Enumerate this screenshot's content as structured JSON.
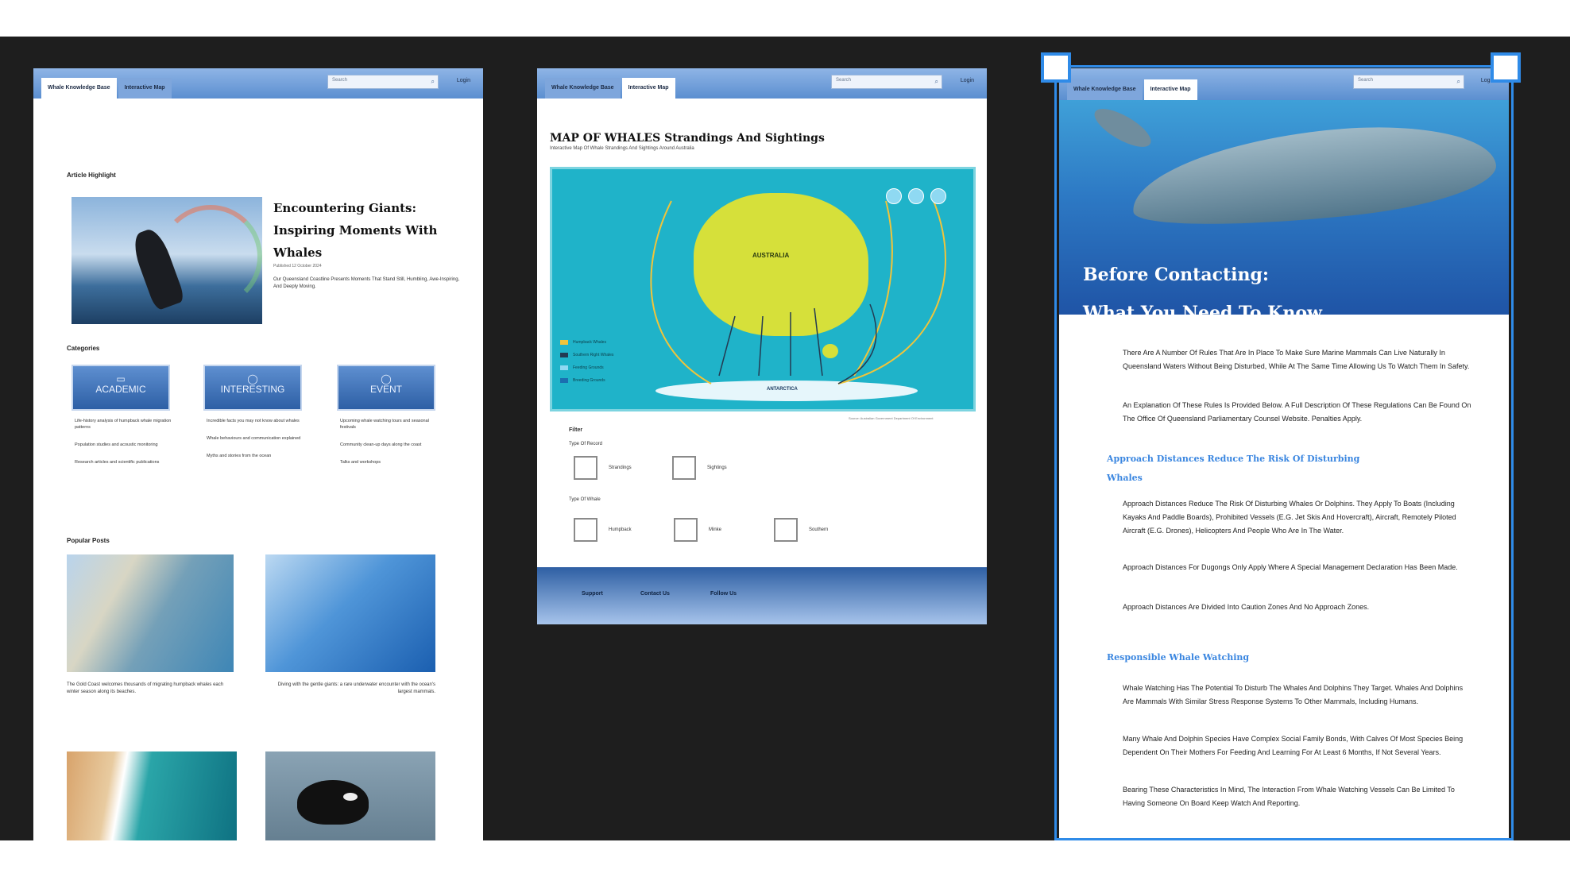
{
  "artboard1": {
    "tabs": [
      "Whale Knowledge Base",
      "Interactive Map"
    ],
    "search_placeholder": "Search",
    "login": "Login",
    "section_highlight": "Article Highlight",
    "hero": {
      "title": "Encountering Giants: Inspiring Moments With Whales",
      "meta": "Published 12 October 2024",
      "excerpt": "Our Queensland Coastline Presents Moments That Stand Still, Humbling, Awe-Inspiring, And Deeply Moving."
    },
    "section_categories": "Categories",
    "categories": [
      {
        "icon": "book-icon",
        "label": "ACADEMIC",
        "items": [
          "Life-history analysis of humpback whale migration patterns",
          "Population studies and acoustic monitoring",
          "Research articles and scientific publications"
        ]
      },
      {
        "icon": "bulb-icon",
        "label": "INTERESTING",
        "items": [
          "Incredible facts you may not know about whales",
          "Whale behaviours and communication explained",
          "Myths and stories from the ocean"
        ]
      },
      {
        "icon": "event-icon",
        "label": "EVENT",
        "items": [
          "Upcoming whale watching tours and seasonal festivals",
          "Community clean-up days along the coast",
          "Talks and workshops"
        ]
      }
    ],
    "section_popular": "Popular Posts",
    "popular_captions": [
      "The Gold Coast welcomes thousands of migrating humpback whales each winter season along its beaches.",
      "Diving with the gentle giants: a rare underwater encounter with the ocean's largest mammals."
    ]
  },
  "artboard2": {
    "tabs": [
      "Whale Knowledge Base",
      "Interactive Map"
    ],
    "search_placeholder": "Search",
    "login": "Login",
    "title": "MAP OF WHALES Strandings And Sightings",
    "subtitle": "Interactive Map Of Whale Strandings And Sightings Around Australia",
    "map": {
      "region_label": "AUSTRALIA",
      "antarctica_label": "ANTARCTICA",
      "legend": [
        "Humpback Whales",
        "Southern Right Whales",
        "Feeding Grounds",
        "Breeding Grounds"
      ],
      "credit": "Source: Australian Government Department Of Environment"
    },
    "filter_label": "Filter",
    "group1_label": "Type Of Record",
    "group1": [
      "Strandings",
      "Sightings"
    ],
    "group2_label": "Type Of Whale",
    "group2": [
      "Humpback",
      "Minke",
      "Southern"
    ],
    "footer_links": [
      "Support",
      "Contact Us",
      "Follow Us"
    ]
  },
  "artboard3": {
    "tabs": [
      "Whale Knowledge Base",
      "Interactive Map"
    ],
    "search_placeholder": "Search",
    "login": "Login",
    "banner_title_line1": "Before Contacting:",
    "banner_title_line2": "What You Need To Know",
    "p1": "There Are A Number Of Rules That Are In Place To Make Sure Marine Mammals Can Live Naturally In Queensland Waters Without Being Disturbed, While At The Same Time Allowing Us To Watch Them In Safety.",
    "p2": "An Explanation Of These Rules Is Provided Below. A Full Description Of These Regulations Can Be Found On The Office Of Queensland Parliamentary Counsel Website. Penalties Apply.",
    "h1": "Approach Distances Reduce The Risk Of Disturbing Whales",
    "p3": "Approach Distances Reduce The Risk Of Disturbing Whales Or Dolphins. They Apply To Boats (Including Kayaks And Paddle Boards), Prohibited Vessels (E.G. Jet Skis And Hovercraft), Aircraft, Remotely Piloted Aircraft (E.G. Drones), Helicopters And People Who Are In The Water.",
    "p4": "Approach Distances For Dugongs Only Apply Where A Special Management Declaration Has Been Made.",
    "p5": "Approach Distances Are Divided Into Caution Zones And No Approach Zones.",
    "h2": "Responsible Whale Watching",
    "p6": "Whale Watching Has The Potential To Disturb The Whales And Dolphins They Target. Whales And Dolphins Are Mammals With Similar Stress Response Systems To Other Mammals, Including Humans.",
    "p7": "Many Whale And Dolphin Species Have Complex Social Family Bonds, With Calves Of Most Species Being Dependent On Their Mothers For Feeding And Learning For At Least 6 Months, If Not Several Years.",
    "p8": "Bearing These Characteristics In Mind, The Interaction From Whale Watching Vessels Can Be Limited To Having Someone On Board Keep Watch And Reporting."
  }
}
